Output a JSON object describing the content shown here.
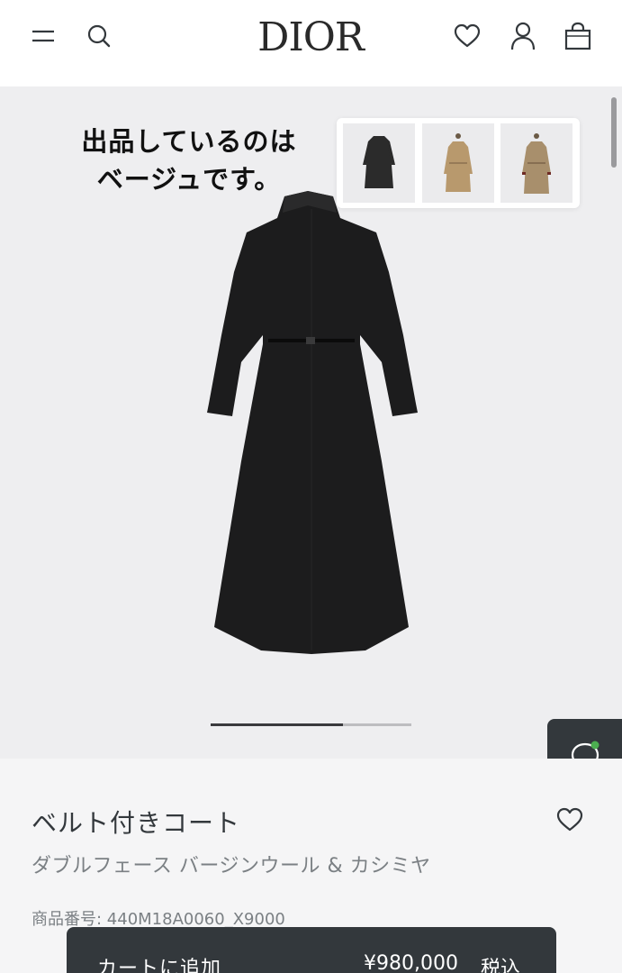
{
  "header": {
    "brand": "DIOR",
    "icons": [
      "menu-icon",
      "search-icon",
      "heart-icon",
      "account-icon",
      "bag-icon"
    ]
  },
  "hero": {
    "overlay_text": [
      "出品しているのは",
      "ベージュです。"
    ],
    "thumbnails": [
      {
        "name": "black coat",
        "color": "#2b2b2b"
      },
      {
        "name": "beige trench",
        "color": "#b8996d"
      },
      {
        "name": "beige trench long",
        "color": "#a88f6c"
      }
    ],
    "gallery_progress": 0.66
  },
  "product": {
    "title": "ベルト付きコート",
    "subtitle": "ダブルフェース バージンウール & カシミヤ",
    "ref_label": "商品番号: ",
    "ref_value": "440M18A0060_X9000"
  },
  "cart": {
    "label": "カートに追加",
    "price": "¥980,000",
    "tax": "税込"
  },
  "colors": {
    "dark": "#33383c",
    "hero_bg": "#eeeef0",
    "chat_online": "#4caf50"
  }
}
